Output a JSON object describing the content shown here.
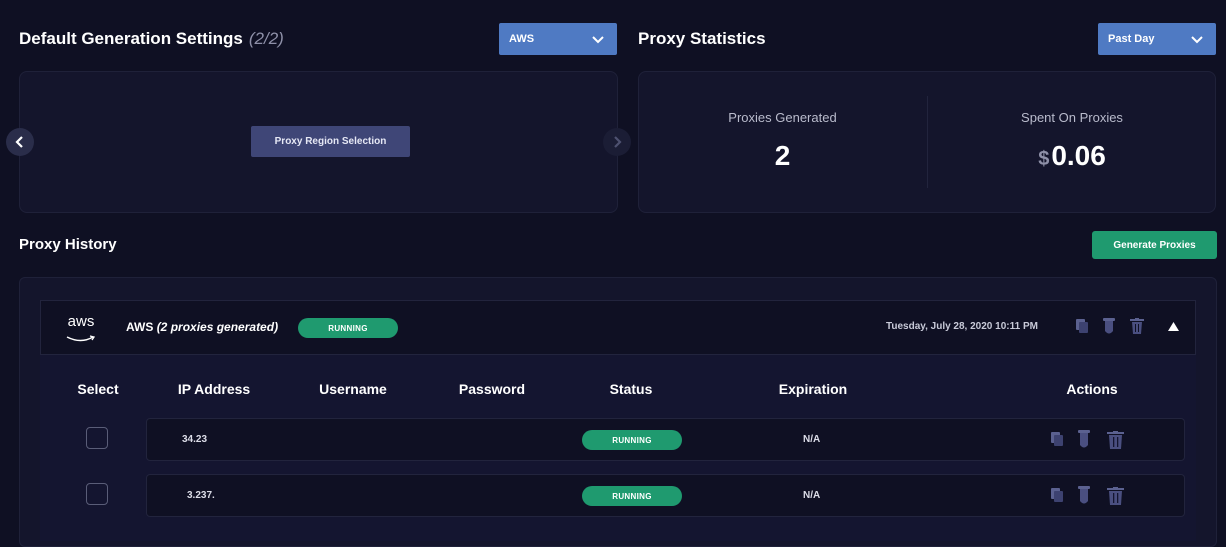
{
  "settings": {
    "title": "Default Generation Settings",
    "count": "(2/2)",
    "provider_select": "AWS",
    "region_button": "Proxy Region Selection"
  },
  "stats": {
    "title": "Proxy Statistics",
    "period_select": "Past Day",
    "generated_label": "Proxies Generated",
    "generated_value": "2",
    "spent_label": "Spent On Proxies",
    "spent_currency": "$",
    "spent_value": "0.06"
  },
  "history": {
    "title": "Proxy History",
    "generate_button": "Generate Proxies",
    "group": {
      "logo_text": "aws",
      "provider": "AWS",
      "subtitle": "(2 proxies generated)",
      "status": "RUNNING",
      "timestamp": "Tuesday, July 28, 2020 10:11 PM"
    },
    "columns": [
      "Select",
      "IP Address",
      "Username",
      "Password",
      "Status",
      "Expiration",
      "Actions"
    ],
    "rows": [
      {
        "ip": "34.23",
        "username": "",
        "password": "",
        "status": "RUNNING",
        "expiration": "N/A"
      },
      {
        "ip": "3.237.",
        "username": "",
        "password": "",
        "status": "RUNNING",
        "expiration": "N/A"
      }
    ]
  },
  "colors": {
    "background": "#0f1023",
    "panel": "#14152c",
    "select_blue": "#4f7ac3",
    "running_green": "#1f9a6f",
    "region_button": "#3f4677"
  },
  "icons": [
    "chevron-left-icon",
    "chevron-right-icon",
    "chevron-down-icon",
    "copy-icon",
    "test-tube-icon",
    "trash-icon",
    "caret-up-icon",
    "aws-logo"
  ]
}
